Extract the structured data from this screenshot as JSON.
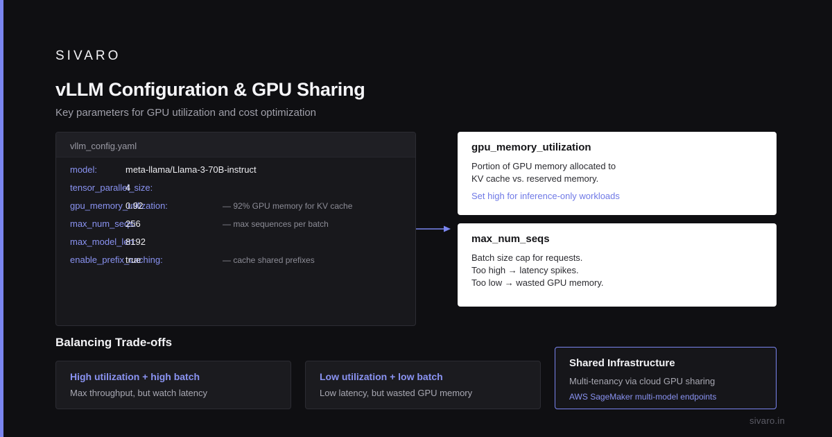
{
  "brand": "SIVARO",
  "header": {
    "title": "vLLM Configuration & GPU Sharing",
    "subtitle": "Key parameters for GPU utilization and cost optimization"
  },
  "config_panel": {
    "filename": "vllm_config.yaml",
    "rows": [
      {
        "key": "model:",
        "value": "meta-llama/Llama-3-70B-instruct",
        "comment": ""
      },
      {
        "key": "tensor_parallel_size:",
        "value": "4",
        "comment": ""
      },
      {
        "key": "gpu_memory_utilization:",
        "value": "0.92",
        "comment": "— 92% GPU memory for KV cache"
      },
      {
        "key": "max_num_seqs:",
        "value": "256",
        "comment": "— max sequences per batch"
      },
      {
        "key": "max_model_len:",
        "value": "8192",
        "comment": ""
      },
      {
        "key": "enable_prefix_caching:",
        "value": "true",
        "comment": "— cache shared prefixes"
      }
    ]
  },
  "cards": [
    {
      "title": "gpu_memory_utilization",
      "lines": [
        "Portion of GPU memory allocated to",
        "KV cache vs. reserved memory."
      ],
      "link": "Set high for inference-only workloads"
    },
    {
      "title": "max_num_seqs",
      "lines": [
        "Batch size cap for requests.",
        "Too high → latency spikes.",
        "Too low → wasted GPU memory."
      ],
      "link": ""
    }
  ],
  "tradeoffs": {
    "title": "Balancing Trade-offs",
    "items": [
      {
        "title": "High utilization + high batch",
        "desc": "Max throughput, but watch latency"
      },
      {
        "title": "Low utilization + low batch",
        "desc": "Low latency, but wasted GPU memory"
      }
    ],
    "infra": {
      "title": "Shared Infrastructure",
      "desc": "Multi-tenancy via cloud GPU sharing",
      "link": "AWS SageMaker multi-model endpoints"
    }
  },
  "footer": "sivaro.in",
  "colors": {
    "accent": "#7a85f0",
    "background": "#0f0f12",
    "card": "#ffffff"
  }
}
